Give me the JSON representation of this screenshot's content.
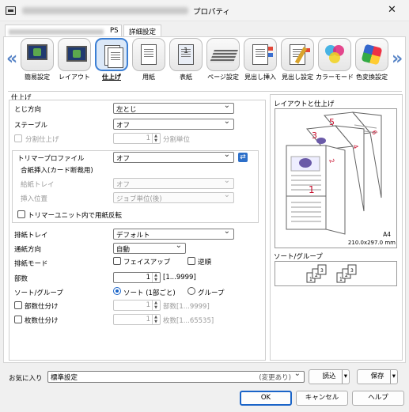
{
  "window": {
    "title_suffix": "プロパティ",
    "close_glyph": "✕"
  },
  "tabs": {
    "printer_suffix": "PS",
    "advanced": "詳細設定"
  },
  "nav": {
    "left_arrow": "«",
    "right_arrow": "»",
    "items": [
      {
        "label": "簡易設定"
      },
      {
        "label": "レイアウト"
      },
      {
        "label": "仕上げ",
        "selected": true
      },
      {
        "label": "用紙"
      },
      {
        "label": "表紙"
      },
      {
        "label": "ページ設定"
      },
      {
        "label": "見出し挿入"
      },
      {
        "label": "見出し設定"
      },
      {
        "label": "カラーモード"
      },
      {
        "label": "色変換設定"
      }
    ]
  },
  "icon_texts": {
    "cover_page_number": "1"
  },
  "finishing": {
    "section_title": "仕上げ",
    "binding_label": "とじ方向",
    "binding_value": "左とじ",
    "staple_label": "ステープル",
    "staple_value": "オフ",
    "split_label": "分割仕上げ",
    "split_value": "1",
    "split_unit": "分割単位",
    "trimmer_label": "トリマープロファイル",
    "trimmer_value": "オフ",
    "insert_title": "合紙挿入(カード断裁用)",
    "feed_tray_label": "給紙トレイ",
    "feed_tray_value": "オフ",
    "insert_pos_label": "挿入位置",
    "insert_pos_value": "ジョブ単位(後)",
    "reverse_label": "トリマーユニット内で用紙反転",
    "output_tray_label": "排紙トレイ",
    "output_tray_value": "デフォルト",
    "direction_label": "通紙方向",
    "direction_value": "自動",
    "output_mode_label": "排紙モード",
    "face_up_label": "フェイスアップ",
    "reverse_order_label": "逆順",
    "copies_label": "部数",
    "copies_value": "1",
    "copies_range": "[1...9999]",
    "sort_group_label": "ソート/グループ",
    "sort_label": "ソート (1部ごと)",
    "group_label": "グループ",
    "copy_sep_label": "部数仕分け",
    "copy_sep_value": "1",
    "copy_sep_range": "部数[1...9999]",
    "sheet_sep_label": "枚数仕分け",
    "sheet_sep_value": "1",
    "sheet_sep_range": "枚数[1...65535]"
  },
  "preview": {
    "title": "レイアウトと仕上げ",
    "page_numbers": [
      "1",
      "2",
      "3",
      "4",
      "5",
      "6"
    ],
    "paper_size": "A4",
    "paper_dims": "210.0x297.0 mm",
    "sort_title": "ソート/グループ",
    "sort_page_numbers": [
      "1",
      "2",
      "3"
    ]
  },
  "favorites": {
    "label": "お気に入り",
    "value": "標準設定",
    "changed": "(変更あり)",
    "load": "読込",
    "save": "保存"
  },
  "buttons": {
    "ok": "OK",
    "cancel": "キャンセル",
    "help": "ヘルプ"
  },
  "colors": {
    "accent": "#1a64c8",
    "page_number": "#c8102e",
    "violet": "#6a5aa8"
  }
}
